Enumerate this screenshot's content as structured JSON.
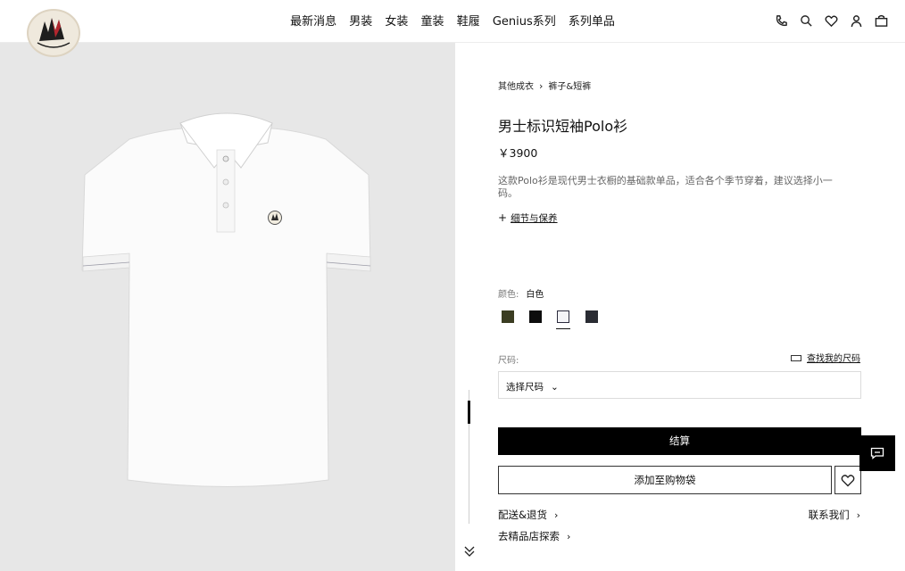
{
  "header": {
    "logo_text": "MONCLER",
    "nav": [
      "最新消息",
      "男装",
      "女装",
      "童装",
      "鞋履",
      "Genius系列",
      "系列单品"
    ],
    "icons": [
      "phone-icon",
      "search-icon",
      "heart-icon",
      "user-icon",
      "bag-icon"
    ]
  },
  "product": {
    "breadcrumb": [
      "其他成衣",
      "裤子&短裤"
    ],
    "title": "男士标识短袖Polo衫",
    "price": "￥3900",
    "description": "这款Polo衫是现代男士衣橱的基础款单品，适合各个季节穿着，建议选择小一码。",
    "details_link": "细节与保养",
    "color_label": "颜色:",
    "color_value": "白色",
    "swatches": [
      "#3b3d22",
      "#0d0d0d",
      "#f4f4f7",
      "#2a2c33"
    ],
    "selected_swatch": 2,
    "size_label": "尺码:",
    "size_guide": "查找我的尺码",
    "size_placeholder": "选择尺码",
    "checkout": "结算",
    "add_to_bag": "添加至购物袋"
  },
  "footer_links": {
    "shipping": "配送&退货",
    "contact": "联系我们",
    "stores": "去精品店探索"
  },
  "colors": {
    "accent": "#000000",
    "image_bg": "#e7e7e7"
  }
}
